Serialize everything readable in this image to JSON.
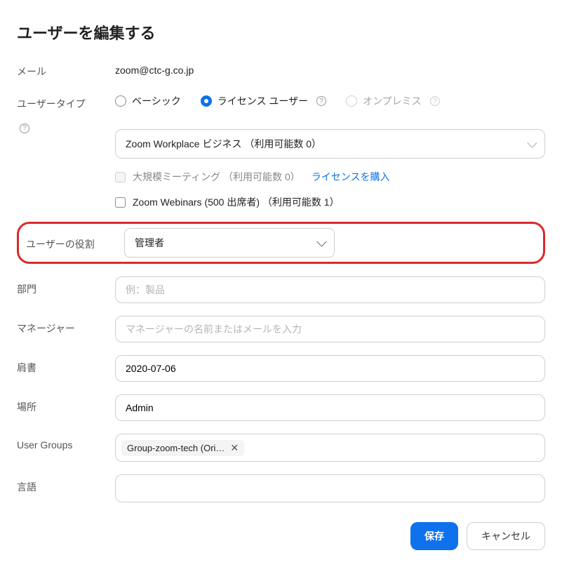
{
  "title": "ユーザーを編集する",
  "labels": {
    "email": "メール",
    "userType": "ユーザータイプ",
    "userRole": "ユーザーの役割",
    "department": "部門",
    "manager": "マネージャー",
    "jobTitle": "肩書",
    "location": "場所",
    "userGroups": "User Groups",
    "language": "言語"
  },
  "email": "zoom@ctc-g.co.jp",
  "userType": {
    "basic": "ベーシック",
    "licensed": "ライセンス ユーザー",
    "onprem": "オンプレミス"
  },
  "license": {
    "plan": "Zoom Workplace ビジネス （利用可能数 0）",
    "largeMeeting": "大規模ミーティング （利用可能数 0）",
    "purchaseLink": "ライセンスを購入",
    "webinars": "Zoom Webinars (500 出席者) （利用可能数 1）"
  },
  "userRole": "管理者",
  "department": {
    "placeholder": "例：製品"
  },
  "manager": {
    "placeholder": "マネージャーの名前またはメールを入力"
  },
  "jobTitle": "2020-07-06",
  "location": "Admin",
  "userGroups": {
    "chip": "Group-zoom-tech (Ori…"
  },
  "footer": {
    "save": "保存",
    "cancel": "キャンセル"
  }
}
